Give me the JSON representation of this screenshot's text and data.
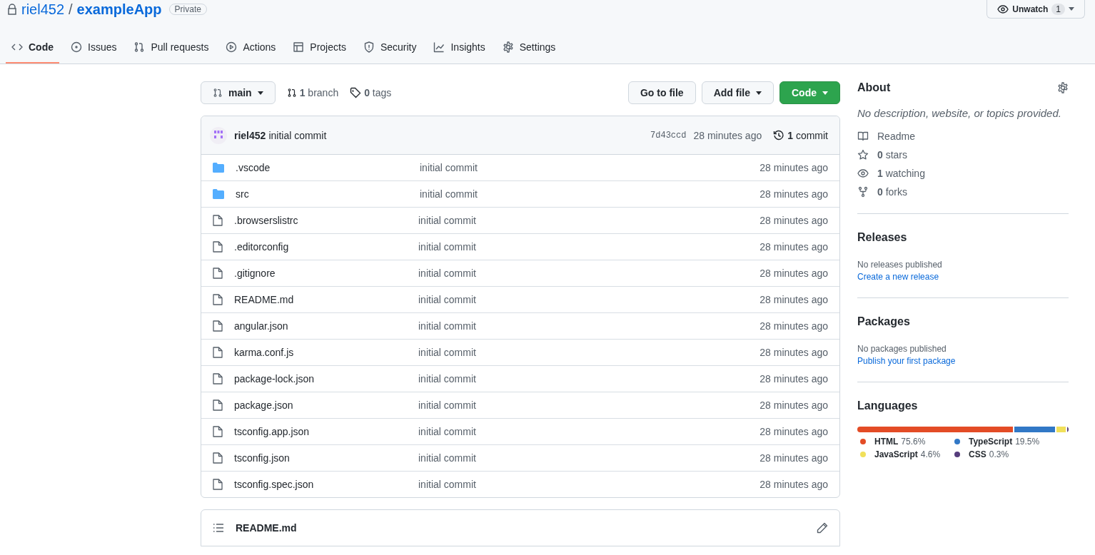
{
  "repo": {
    "owner": "riel452",
    "separator": "/",
    "name": "exampleApp",
    "visibility": "Private"
  },
  "watch": {
    "label": "Unwatch",
    "count": "1"
  },
  "tabs": [
    {
      "label": "Code",
      "selected": true
    },
    {
      "label": "Issues",
      "selected": false
    },
    {
      "label": "Pull requests",
      "selected": false
    },
    {
      "label": "Actions",
      "selected": false
    },
    {
      "label": "Projects",
      "selected": false
    },
    {
      "label": "Security",
      "selected": false
    },
    {
      "label": "Insights",
      "selected": false
    },
    {
      "label": "Settings",
      "selected": false
    }
  ],
  "toolbar": {
    "branch_button": "main",
    "branches": "**1** branch",
    "tags": "**0** tags",
    "go_to_file": "Go to file",
    "add_file": "Add file",
    "code": "Code"
  },
  "commit": {
    "author": "riel452",
    "message": "initial commit",
    "sha": "7d43ccd",
    "time": "28 minutes ago",
    "count": "**1** commit"
  },
  "files": [
    {
      "kind": "folder",
      "name": ".vscode",
      "message": "initial commit",
      "time": "28 minutes ago"
    },
    {
      "kind": "folder",
      "name": "src",
      "message": "initial commit",
      "time": "28 minutes ago"
    },
    {
      "kind": "file",
      "name": ".browserslistrc",
      "message": "initial commit",
      "time": "28 minutes ago"
    },
    {
      "kind": "file",
      "name": ".editorconfig",
      "message": "initial commit",
      "time": "28 minutes ago"
    },
    {
      "kind": "file",
      "name": ".gitignore",
      "message": "initial commit",
      "time": "28 minutes ago"
    },
    {
      "kind": "file",
      "name": "README.md",
      "message": "initial commit",
      "time": "28 minutes ago"
    },
    {
      "kind": "file",
      "name": "angular.json",
      "message": "initial commit",
      "time": "28 minutes ago"
    },
    {
      "kind": "file",
      "name": "karma.conf.js",
      "message": "initial commit",
      "time": "28 minutes ago"
    },
    {
      "kind": "file",
      "name": "package-lock.json",
      "message": "initial commit",
      "time": "28 minutes ago"
    },
    {
      "kind": "file",
      "name": "package.json",
      "message": "initial commit",
      "time": "28 minutes ago"
    },
    {
      "kind": "file",
      "name": "tsconfig.app.json",
      "message": "initial commit",
      "time": "28 minutes ago"
    },
    {
      "kind": "file",
      "name": "tsconfig.json",
      "message": "initial commit",
      "time": "28 minutes ago"
    },
    {
      "kind": "file",
      "name": "tsconfig.spec.json",
      "message": "initial commit",
      "time": "28 minutes ago"
    }
  ],
  "readme": {
    "title": "README.md"
  },
  "about": {
    "title": "About",
    "description": "No description, website, or topics provided.",
    "items": [
      {
        "kind": "book",
        "text": "Readme"
      },
      {
        "kind": "star",
        "text": "**0** stars"
      },
      {
        "kind": "eye",
        "text": "**1** watching"
      },
      {
        "kind": "fork",
        "text": "**0** forks"
      }
    ]
  },
  "releases": {
    "title": "Releases",
    "note": "No releases published",
    "link": "Create a new release"
  },
  "packages": {
    "title": "Packages",
    "note": "No packages published",
    "link": "Publish your first package"
  },
  "languages": {
    "title": "Languages",
    "items": [
      {
        "name": "HTML",
        "percent": "75.6%",
        "color": "#e34c26"
      },
      {
        "name": "TypeScript",
        "percent": "19.5%",
        "color": "#3178c6"
      },
      {
        "name": "JavaScript",
        "percent": "4.6%",
        "color": "#f1e05a"
      },
      {
        "name": "CSS",
        "percent": "0.3%",
        "color": "#563d7c"
      }
    ]
  }
}
